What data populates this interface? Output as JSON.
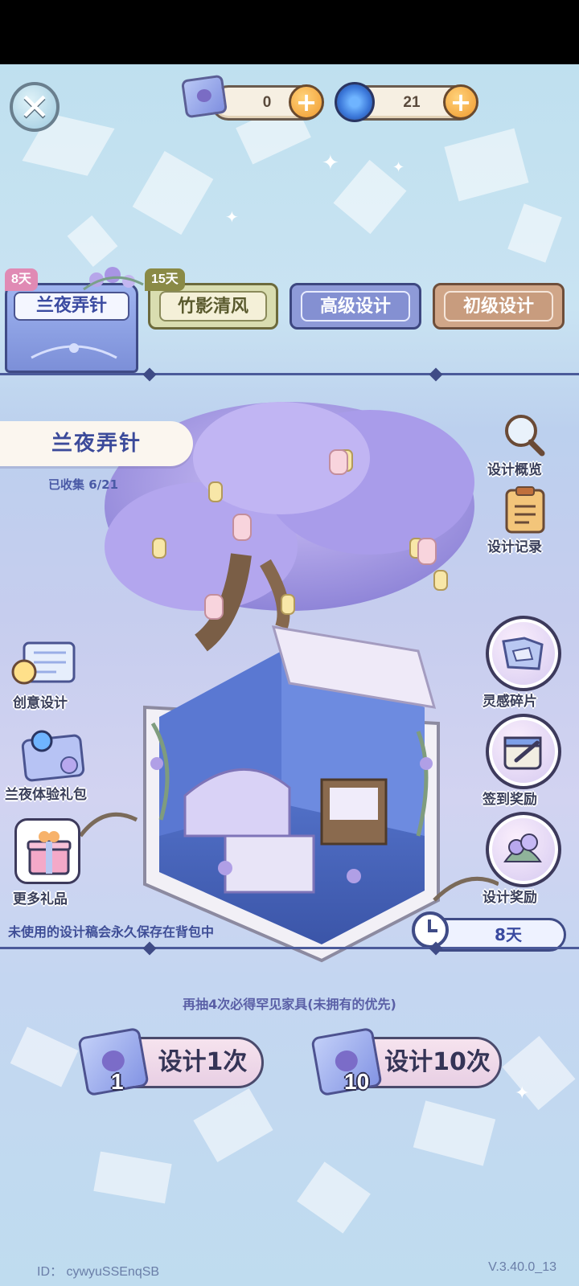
{
  "currency": {
    "scrolls_value": "0",
    "swirl_value": "21"
  },
  "tabs": [
    {
      "label": "兰夜弄针",
      "badge": "8天",
      "active": true
    },
    {
      "label": "竹影清风",
      "badge": "15天",
      "active": false
    },
    {
      "label": "高级设计",
      "active": false
    },
    {
      "label": "初级设计",
      "active": false
    }
  ],
  "collection": {
    "title": "兰夜弄针",
    "collected": "已收集 6/21"
  },
  "right_menu": [
    {
      "label": "设计概览",
      "icon": "magnifier-icon"
    },
    {
      "label": "设计记录",
      "icon": "clipboard-icon"
    },
    {
      "label": "灵感碎片",
      "icon": "map-fragment-icon"
    },
    {
      "label": "签到奖励",
      "icon": "calendar-icon"
    },
    {
      "label": "设计奖励",
      "icon": "flower-icon"
    }
  ],
  "left_menu": [
    {
      "label": "创意设计",
      "icon": "lightbulb-board-icon"
    },
    {
      "label": "兰夜体验礼包",
      "icon": "gift-pack-icon"
    },
    {
      "label": "更多礼品",
      "icon": "gift-box-icon"
    }
  ],
  "timer": "8天",
  "note": "未使用的设计稿会永久保存在背包中",
  "pity_text": "再抽4次必得罕见家具(未拥有的优先)",
  "draw": {
    "single": {
      "label": "设计1次",
      "cost": "1"
    },
    "multi": {
      "label": "设计10次",
      "cost": "10"
    }
  },
  "footer": {
    "id": "ID： cywyuSSEnqSB",
    "version": "V.3.40.0_13"
  },
  "colors": {
    "accent": "#3f4b86",
    "badge_pink": "#e08ab4",
    "badge_olive": "#8a8a46",
    "plus_orange": "#f09a2e"
  }
}
